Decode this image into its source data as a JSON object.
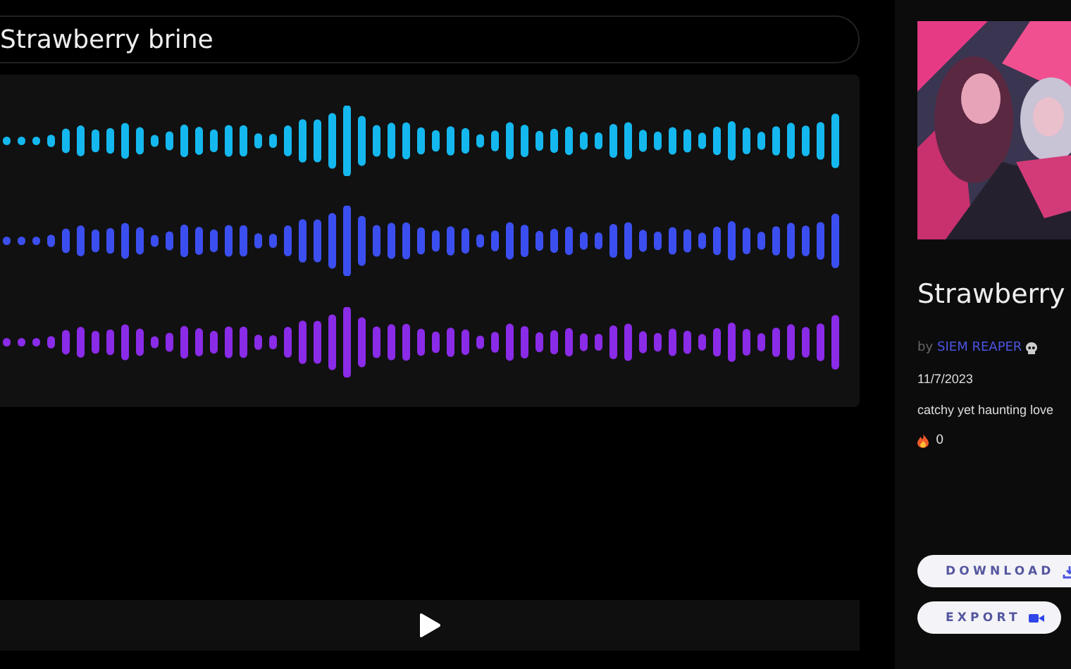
{
  "title_field": {
    "value": "Strawberry brine"
  },
  "waveforms": [
    {
      "color": "#14b8ee"
    },
    {
      "color": "#3b4ff0"
    },
    {
      "color": "#8a2be8"
    }
  ],
  "player": {
    "playing": false
  },
  "track": {
    "title": "Strawberry",
    "by": "by",
    "author": "SIEM REAPER",
    "date": "11/7/2023",
    "description": "catchy yet haunting love",
    "likes": "0"
  },
  "buttons": [
    {
      "label": "DOWNLOAD",
      "kind": "download"
    },
    {
      "label": "EXPORT",
      "kind": "export"
    }
  ]
}
